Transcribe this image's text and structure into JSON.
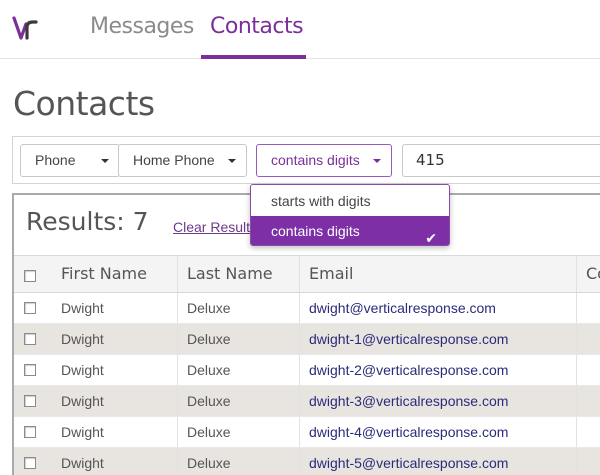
{
  "nav": {
    "logo_text": "vr",
    "tabs": [
      {
        "label": "Messages"
      },
      {
        "label": "Contacts"
      }
    ]
  },
  "page": {
    "title": "Contacts"
  },
  "filters": {
    "field": "Phone",
    "subfield": "Home Phone",
    "operator": "contains digits",
    "value": "415"
  },
  "operator_menu": {
    "items": [
      {
        "label": "starts with digits",
        "selected": false
      },
      {
        "label": "contains digits",
        "selected": true
      }
    ],
    "check_icon": "✔"
  },
  "results": {
    "title": "Results: 7",
    "clear_label": "Clear Results"
  },
  "table": {
    "columns": [
      "First Name",
      "Last Name",
      "Email",
      "Co"
    ],
    "rows": [
      {
        "first": "Dwight",
        "last": "Deluxe",
        "email": "dwight@verticalresponse.com"
      },
      {
        "first": "Dwight",
        "last": "Deluxe",
        "email": "dwight-1@verticalresponse.com"
      },
      {
        "first": "Dwight",
        "last": "Deluxe",
        "email": "dwight-2@verticalresponse.com"
      },
      {
        "first": "Dwight",
        "last": "Deluxe",
        "email": "dwight-3@verticalresponse.com"
      },
      {
        "first": "Dwight",
        "last": "Deluxe",
        "email": "dwight-4@verticalresponse.com"
      },
      {
        "first": "Dwight",
        "last": "Deluxe",
        "email": "dwight-5@verticalresponse.com"
      }
    ]
  },
  "colors": {
    "brand_purple": "#7a2f9a",
    "menu_selected": "#7d2fa6",
    "alt_row": "#e8e4e0"
  },
  "icons": {
    "caret": "caret-down-icon",
    "check": "check-icon",
    "checkbox": "checkbox-icon",
    "logo": "vr-logo"
  }
}
